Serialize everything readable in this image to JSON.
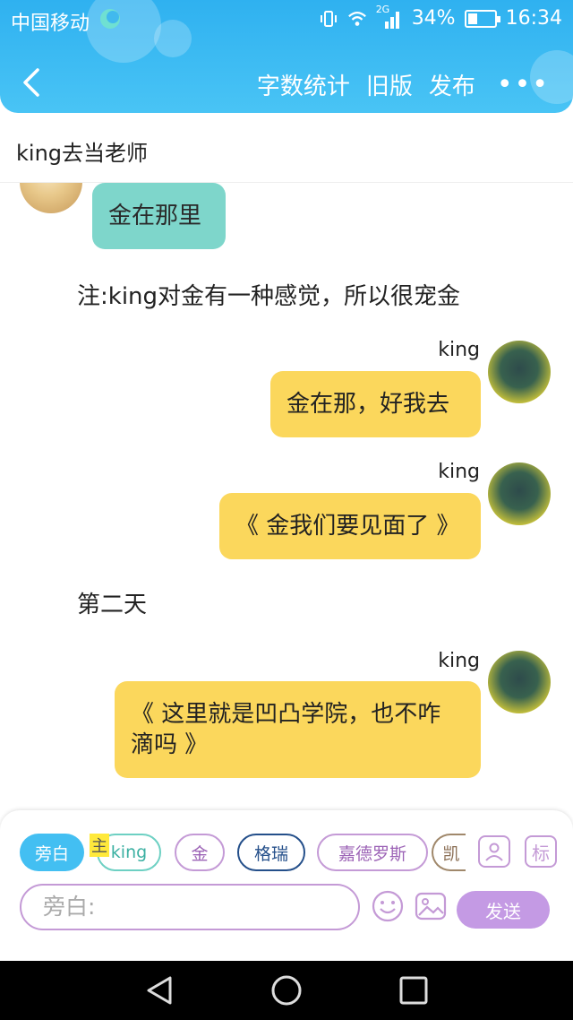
{
  "status_bar": {
    "carrier": "中国移动",
    "network": "2G",
    "battery": "34%",
    "time": "16:34"
  },
  "nav": {
    "actions": [
      "字数统计",
      "旧版",
      "发布"
    ],
    "more": "•••"
  },
  "story_title": "king去当老师",
  "messages": {
    "m1": "金在那里",
    "narration1": "注:king对金有一种感觉，所以很宠金",
    "name2": "king",
    "m2": "金在那，好我去",
    "name3": "king",
    "m3": "《 金我们要见面了 》",
    "narration2": "第二天",
    "name4": "king",
    "m4_line1": "《 这里就是凹凸学院，也不咋",
    "m4_line2": "滴吗 》"
  },
  "composer": {
    "chips": [
      "旁白",
      "king",
      "金",
      "格瑞",
      "嘉德罗斯",
      "凯"
    ],
    "main_badge": "主",
    "tool_tag": "标",
    "input_placeholder": "旁白:",
    "send_label": "发送"
  },
  "colors": {
    "header": "#2fb1f0",
    "teal_bubble": "#7ed6cb",
    "yellow_bubble": "#fbd75c",
    "accent_purple": "#c49ae4"
  }
}
